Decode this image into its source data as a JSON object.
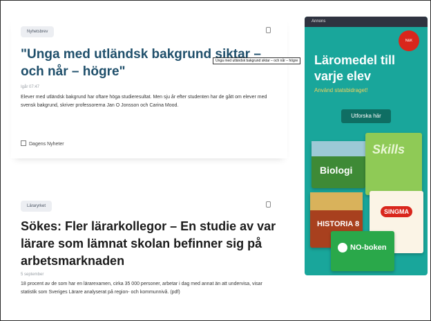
{
  "articles": [
    {
      "tag": "Nyhetsbrev",
      "title": "\"Unga med utländsk bakgrund siktar – och når – högre\"",
      "date": "Igår 07:47",
      "text": "Elever med utländsk bakgrund har oftare höga studieresultat. Men sju år efter studenten har de gått om elever med svensk bakgrund, skriver professorerna Jan O Jonsson och Carina Mood.",
      "source": "Dagens Nyheter"
    },
    {
      "tag": "Läraryrket",
      "title": "Sökes: Fler lärarkollegor – En studie av var lärare som lämnat skolan befinner sig på arbetsmarknaden",
      "date": "5 september",
      "text": "18 procent av de som har en lärarexamen, cirka 35 000 personer, arbetar i dag med annat än att undervisa, visar statistik som Sveriges Lärare analyserat på region- och kommunnivå. (pdf)"
    }
  ],
  "tooltip": "Unga med utländsk bakgrund siktar – och når – högre",
  "ad": {
    "top_label": "Annons",
    "brand": "NATUR & KULTUR",
    "headline": "Läromedel till varje elev",
    "subline": "Använd statsbidraget!",
    "button": "Utforska här",
    "books": {
      "biologi": "Biologi",
      "skills": "Skills",
      "historia": "HISTORIA 8",
      "singma": "SINGMA",
      "no": "NO-boken"
    }
  },
  "colors": {
    "title_blue": "#1f4f6b",
    "ad_teal": "#19a69b",
    "ad_dark": "#2f3340",
    "ad_sub_yellow": "#f3d35c",
    "brand_red": "#d9261c"
  }
}
